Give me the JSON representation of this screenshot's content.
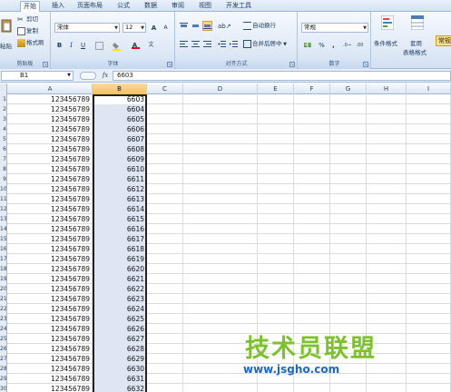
{
  "tabs": [
    "开始",
    "插入",
    "页面布局",
    "公式",
    "数据",
    "审阅",
    "视图",
    "开发工具"
  ],
  "clipboard": {
    "paste": "粘贴",
    "cut": "剪切",
    "copy": "复制",
    "format_painter": "格式刷",
    "label": "剪贴板"
  },
  "font": {
    "name": "宋体",
    "size": "12",
    "bold": "B",
    "italic": "I",
    "underline": "U",
    "grow": "A",
    "shrink": "A",
    "color_a": "A",
    "label": "字体"
  },
  "alignment": {
    "wrap": "自动换行",
    "merge": "合并后居中",
    "label": "对齐方式"
  },
  "number": {
    "format": "常规",
    "percent": "%",
    "comma": ",",
    "label": "数字"
  },
  "styles": {
    "conditional": "条件格式",
    "table_format": "套用",
    "table_format2": "表格格式",
    "cell_style": "常规"
  },
  "formula_bar": {
    "name_box": "B1",
    "fx": "fx",
    "value": "6603"
  },
  "columns": [
    "A",
    "B",
    "C",
    "D",
    "E",
    "F",
    "G",
    "H",
    "I"
  ],
  "rows": [
    {
      "n": "1",
      "a": "123456789",
      "b": "6603"
    },
    {
      "n": "2",
      "a": "123456789",
      "b": "6604"
    },
    {
      "n": "3",
      "a": "123456789",
      "b": "6605"
    },
    {
      "n": "4",
      "a": "123456789",
      "b": "6606"
    },
    {
      "n": "5",
      "a": "123456789",
      "b": "6607"
    },
    {
      "n": "6",
      "a": "123456789",
      "b": "6608"
    },
    {
      "n": "7",
      "a": "123456789",
      "b": "6609"
    },
    {
      "n": "8",
      "a": "123456789",
      "b": "6610"
    },
    {
      "n": "9",
      "a": "123456789",
      "b": "6611"
    },
    {
      "n": "10",
      "a": "123456789",
      "b": "6612"
    },
    {
      "n": "11",
      "a": "123456789",
      "b": "6613"
    },
    {
      "n": "12",
      "a": "123456789",
      "b": "6614"
    },
    {
      "n": "13",
      "a": "123456789",
      "b": "6615"
    },
    {
      "n": "14",
      "a": "123456789",
      "b": "6616"
    },
    {
      "n": "15",
      "a": "123456789",
      "b": "6617"
    },
    {
      "n": "16",
      "a": "123456789",
      "b": "6618"
    },
    {
      "n": "17",
      "a": "123456789",
      "b": "6619"
    },
    {
      "n": "18",
      "a": "123456789",
      "b": "6620"
    },
    {
      "n": "19",
      "a": "123456789",
      "b": "6621"
    },
    {
      "n": "20",
      "a": "123456789",
      "b": "6622"
    },
    {
      "n": "21",
      "a": "123456789",
      "b": "6623"
    },
    {
      "n": "22",
      "a": "123456789",
      "b": "6624"
    },
    {
      "n": "23",
      "a": "123456789",
      "b": "6625"
    },
    {
      "n": "24",
      "a": "123456789",
      "b": "6626"
    },
    {
      "n": "25",
      "a": "123456789",
      "b": "6627"
    },
    {
      "n": "26",
      "a": "123456789",
      "b": "6628"
    },
    {
      "n": "27",
      "a": "123456789",
      "b": "6629"
    },
    {
      "n": "28",
      "a": "123456789",
      "b": "6630"
    },
    {
      "n": "29",
      "a": "123456789",
      "b": "6631"
    },
    {
      "n": "30",
      "a": "123456789",
      "b": "6632"
    }
  ],
  "watermark": {
    "text": "技术员联盟",
    "url": "www.jsgho.com"
  },
  "colors": {
    "selection": "#dde6f2",
    "header_selected": "#f1c15f",
    "watermark_green": "#7cc22b",
    "watermark_blue": "#1c67c7"
  }
}
